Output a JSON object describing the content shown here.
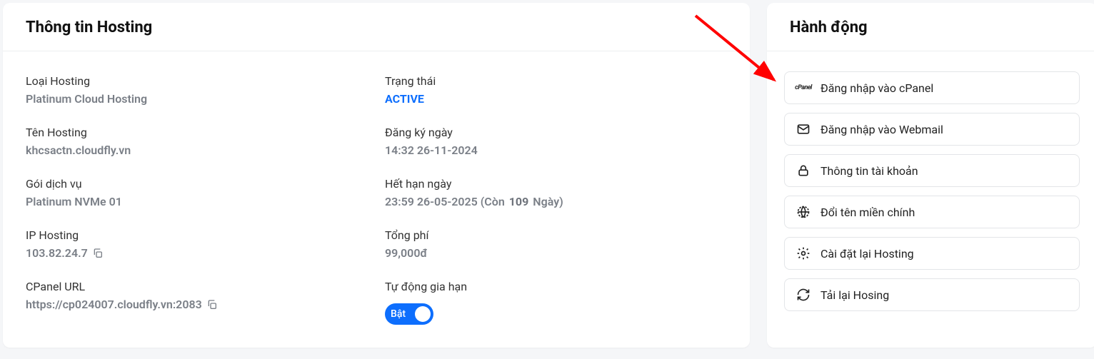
{
  "info": {
    "title": "Thông tin Hosting",
    "fields": {
      "hosting_type": {
        "label": "Loại Hosting",
        "value": "Platinum Cloud Hosting"
      },
      "status": {
        "label": "Trạng thái",
        "value": "ACTIVE"
      },
      "hosting_name": {
        "label": "Tên Hosting",
        "value": "khcsactn.cloudfly.vn"
      },
      "registered": {
        "label": "Đăng ký ngày",
        "value": "14:32 26-11-2024"
      },
      "plan": {
        "label": "Gói dịch vụ",
        "value": "Platinum NVMe 01"
      },
      "expires": {
        "label": "Hết hạn ngày",
        "value_prefix": "23:59 26-05-2025 (Còn ",
        "value_bold": "109",
        "value_suffix": " Ngày)"
      },
      "ip": {
        "label": "IP Hosting",
        "value": "103.82.24.7"
      },
      "total": {
        "label": "Tổng phí",
        "value": "99,000đ"
      },
      "cpanel_url": {
        "label": "CPanel URL",
        "value": "https://cp024007.cloudfly.vn:2083"
      },
      "auto_renew": {
        "label": "Tự động gia hạn",
        "toggle": "Bật"
      }
    }
  },
  "actions": {
    "title": "Hành động",
    "items": [
      {
        "icon": "cpanel",
        "label": "Đăng nhập vào cPanel",
        "name": "login-cpanel-button"
      },
      {
        "icon": "mail",
        "label": "Đăng nhập vào Webmail",
        "name": "login-webmail-button"
      },
      {
        "icon": "lock",
        "label": "Thông tin tài khoản",
        "name": "account-info-button"
      },
      {
        "icon": "globe",
        "label": "Đổi tên miền chính",
        "name": "change-domain-button"
      },
      {
        "icon": "gear",
        "label": "Cài đặt lại Hosting",
        "name": "reinstall-hosting-button"
      },
      {
        "icon": "refresh",
        "label": "Tải lại Hosing",
        "name": "reload-hosting-button"
      }
    ]
  }
}
